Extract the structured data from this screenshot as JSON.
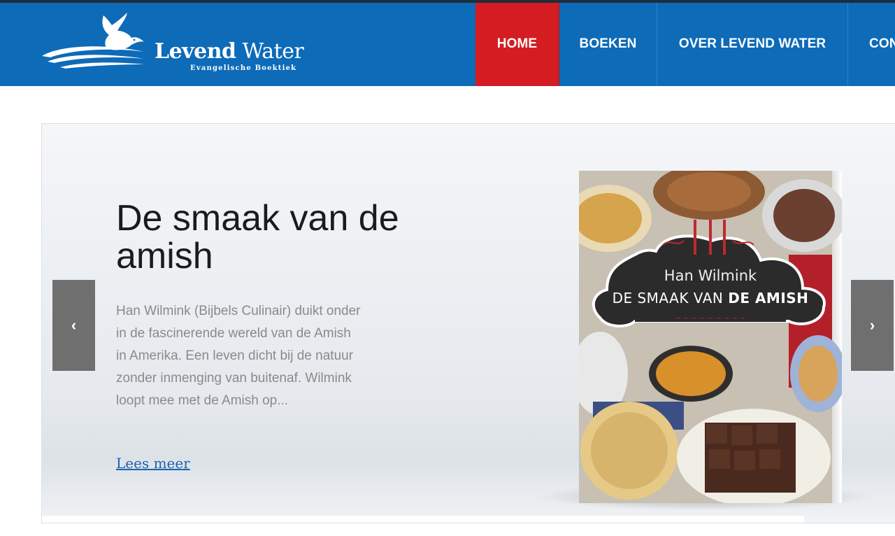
{
  "brand": {
    "name_bold": "Levend",
    "name_regular": "Water",
    "tagline": "Evangelische Boektiek"
  },
  "nav": {
    "items": [
      {
        "label": "HOME",
        "active": true
      },
      {
        "label": "BOEKEN",
        "active": false
      },
      {
        "label": "OVER LEVEND WATER",
        "active": false
      },
      {
        "label": "CON",
        "active": false
      }
    ]
  },
  "slide": {
    "title": "De smaak van de amish",
    "description": "Han Wilmink (Bijbels Culinair) duikt onder in de fascinerende wereld van de Amish in Amerika. Een leven dicht bij de natuur zonder inmenging van buitenaf. Wilmink loopt mee met de Amish op...",
    "read_more": "Lees meer",
    "prev_arrow": "‹",
    "next_arrow": "›"
  },
  "book": {
    "author": "Han Wilmink",
    "title_regular": "DE SMAAK VAN",
    "title_bold": "DE AMISH"
  },
  "colors": {
    "header_blue": "#0d6bb8",
    "active_red": "#d41c22",
    "link_blue": "#1a63ad",
    "arrow_gray": "#6f6f6f"
  }
}
